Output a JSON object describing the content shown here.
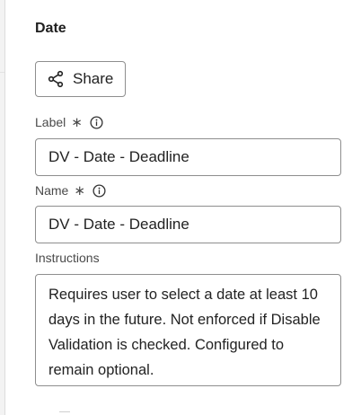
{
  "section": {
    "title": "Date"
  },
  "share_button": {
    "label": "Share",
    "icon": "share-icon"
  },
  "fields": {
    "label": {
      "label": "Label",
      "required_mark": "∗",
      "value": "DV - Date - Deadline"
    },
    "name": {
      "label": "Name",
      "required_mark": "∗",
      "value": "DV - Date - Deadline"
    },
    "instructions": {
      "label": "Instructions",
      "value": "Requires user to select a date at least 10 days in the future. Not enforced if Disable Validation is checked. Configured to remain optional."
    }
  },
  "colors": {
    "border": "#8e8e8e",
    "text": "#222222",
    "label": "#4a4a4a"
  }
}
